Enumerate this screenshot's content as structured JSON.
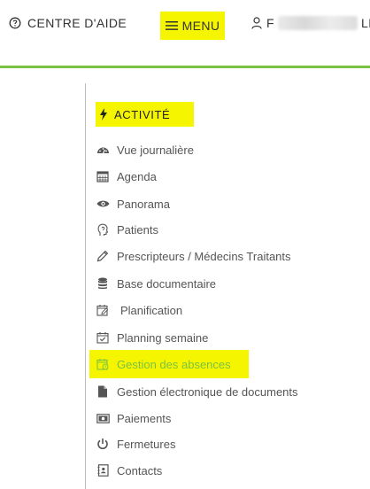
{
  "header": {
    "help_label": "CENTRE D'AIDE",
    "menu_label": "MENU",
    "user_name_start": "F",
    "user_name_end": "LI"
  },
  "colors": {
    "accent_green": "#7cc242",
    "highlight_yellow": "#f5f500"
  },
  "sidebar": {
    "section_title": "ACTIVITÉ",
    "section_icon": "bolt-icon",
    "items": [
      {
        "label": "Vue journalière",
        "icon": "dashboard-icon"
      },
      {
        "label": "Agenda",
        "icon": "calendar-grid-icon"
      },
      {
        "label": "Panorama",
        "icon": "eye-icon"
      },
      {
        "label": "Patients",
        "icon": "head-profile-icon"
      },
      {
        "label": "Prescripteurs / Médecins Traitants",
        "icon": "pencil-icon"
      },
      {
        "label": "Base documentaire",
        "icon": "database-icon"
      },
      {
        "label": "Planification",
        "icon": "calendar-edit-icon"
      },
      {
        "label": "Planning semaine",
        "icon": "calendar-check-icon"
      },
      {
        "label": "Gestion des absences",
        "icon": "calendar-clock-icon",
        "active": true
      },
      {
        "label": "Gestion électronique de documents",
        "icon": "file-icon"
      },
      {
        "label": "Paiements",
        "icon": "money-icon"
      },
      {
        "label": "Fermetures",
        "icon": "power-icon"
      },
      {
        "label": "Contacts",
        "icon": "contact-book-icon"
      }
    ]
  }
}
